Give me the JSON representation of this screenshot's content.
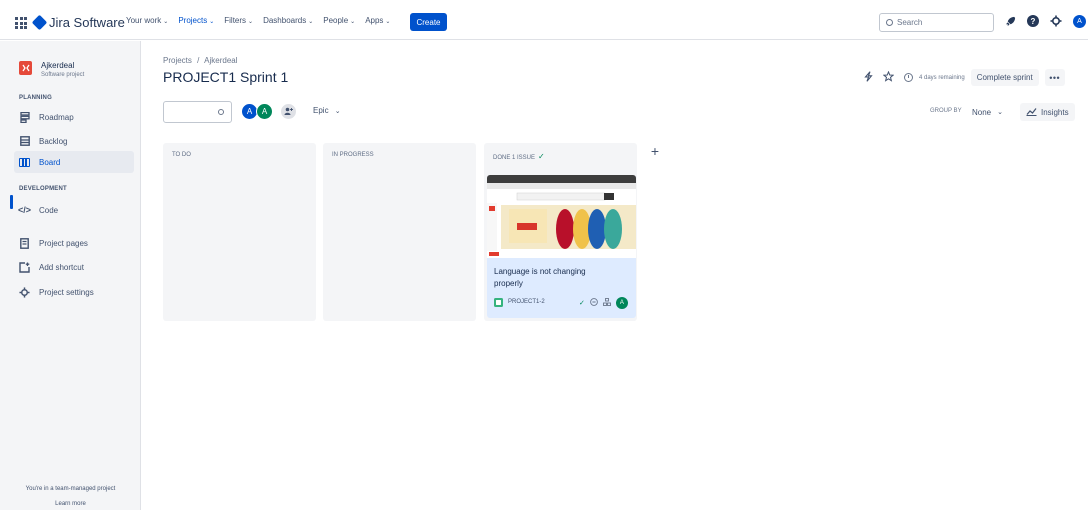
{
  "nav": {
    "product": "Jira Software",
    "items": [
      {
        "label": "Your work",
        "active": false
      },
      {
        "label": "Projects",
        "active": true
      },
      {
        "label": "Filters",
        "active": false
      },
      {
        "label": "Dashboards",
        "active": false
      },
      {
        "label": "People",
        "active": false
      },
      {
        "label": "Apps",
        "active": false
      }
    ],
    "create_label": "Create",
    "search_placeholder": "Search",
    "help_label": "?",
    "user_initial": "A"
  },
  "sidebar": {
    "project_name": "Ajkerdeal",
    "project_type": "Software project",
    "planning_title": "PLANNING",
    "planning_items": [
      {
        "label": "Roadmap",
        "icon": "roadmap-icon"
      },
      {
        "label": "Backlog",
        "icon": "backlog-icon"
      },
      {
        "label": "Board",
        "icon": "board-icon",
        "active": true
      }
    ],
    "development_title": "DEVELOPMENT",
    "development_items": [
      {
        "label": "Code",
        "icon": "code-icon"
      }
    ],
    "other_items": [
      {
        "label": "Project pages",
        "icon": "pages-icon"
      },
      {
        "label": "Add shortcut",
        "icon": "add-shortcut-icon"
      },
      {
        "label": "Project settings",
        "icon": "settings-icon"
      }
    ],
    "team_note": "You're in a team-managed project",
    "learn_more": "Learn more"
  },
  "header": {
    "breadcrumb_root": "Projects",
    "breadcrumb_sep": "/",
    "breadcrumb_project": "Ajkerdeal",
    "title": "PROJECT1 Sprint 1",
    "remaining": "4 days remaining",
    "complete_sprint": "Complete sprint",
    "more": "•••"
  },
  "filters": {
    "avatars": [
      "A",
      "A"
    ],
    "epic_label": "Epic",
    "group_by_label": "GROUP BY",
    "group_by_value": "None",
    "insights_label": "Insights"
  },
  "columns": [
    {
      "title": "TO DO"
    },
    {
      "title": "IN PROGRESS"
    },
    {
      "title": "DONE 1 ISSUE"
    }
  ],
  "card": {
    "title": "Language is not changing properly",
    "key": "PROJECT1-2",
    "assignee_initial": "A"
  },
  "colors": {
    "accent": "#0052cc",
    "done": "#00875a",
    "card_bg": "#deebff",
    "project_avatar": "#e5493a"
  }
}
